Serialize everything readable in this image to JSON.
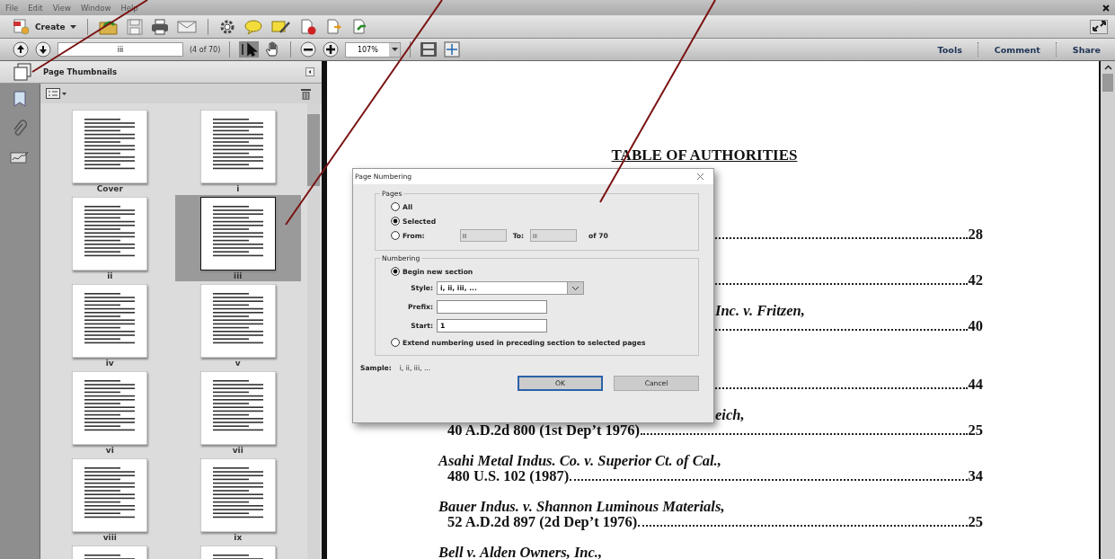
{
  "menu": [
    "File",
    "Edit",
    "View",
    "Window",
    "Help"
  ],
  "create_button": {
    "label": "Create"
  },
  "nav": {
    "page_value": "iii",
    "page_count": "(4 of 70)",
    "zoom": "107%"
  },
  "top_tabs": [
    "Tools",
    "Comment",
    "Share"
  ],
  "panel": {
    "title": "Page Thumbnails"
  },
  "thumbnails": [
    {
      "label": "Cover",
      "selected": false
    },
    {
      "label": "i",
      "selected": false
    },
    {
      "label": "ii",
      "selected": false
    },
    {
      "label": "iii",
      "selected": true
    },
    {
      "label": "iv",
      "selected": false
    },
    {
      "label": "v",
      "selected": false
    },
    {
      "label": "vi",
      "selected": false
    },
    {
      "label": "vii",
      "selected": false
    },
    {
      "label": "viii",
      "selected": false
    },
    {
      "label": "ix",
      "selected": false
    },
    {
      "selected": false
    },
    {
      "selected": false
    }
  ],
  "document": {
    "title": "TABLE OF AUTHORITIES",
    "entries": [
      {
        "page": "28"
      },
      {
        "page": "42"
      },
      {
        "name": "Inc. v. Fritzen,",
        "partial": true,
        "page": "40"
      },
      {
        "page": "44"
      },
      {
        "name": "eich,",
        "partial": true,
        "cite": "40 A.D.2d 800 (1st Dep’t 1976)",
        "page": "25"
      },
      {
        "name": "Asahi Metal Indus. Co. v. Superior Ct. of Cal.,",
        "cite": "480 U.S. 102 (1987)",
        "page": "34"
      },
      {
        "name": "Bauer Indus. v. Shannon Luminous Materials,",
        "cite": "52 A.D.2d 897 (2d Dep’t 1976)",
        "page": "25"
      },
      {
        "name": "Bell v. Alden Owners, Inc.,"
      }
    ]
  },
  "dialog": {
    "title": "Page Numbering",
    "pages_group": {
      "legend": "Pages",
      "options": [
        {
          "label": "All",
          "selected": false
        },
        {
          "label": "Selected",
          "selected": true
        },
        {
          "label": "From:",
          "selected": false
        }
      ],
      "from_value": "iii",
      "to_label": "To:",
      "to_value": "iii",
      "of_text": "of 70",
      "range_disabled": true
    },
    "numbering_group": {
      "legend": "Numbering",
      "options": [
        {
          "label": "Begin new section",
          "selected": true
        },
        {
          "label": "Extend numbering used in preceding section to selected pages",
          "selected": false
        }
      ],
      "style_label": "Style:",
      "style_value": "i, ii, iii, ...",
      "prefix_label": "Prefix:",
      "start_label": "Start:",
      "start_value": "1"
    },
    "sample_label": "Sample:",
    "sample_value": "i, ii, iii, ...",
    "buttons": [
      {
        "label": "OK",
        "default": true
      },
      {
        "label": "Cancel",
        "default": false
      }
    ]
  }
}
